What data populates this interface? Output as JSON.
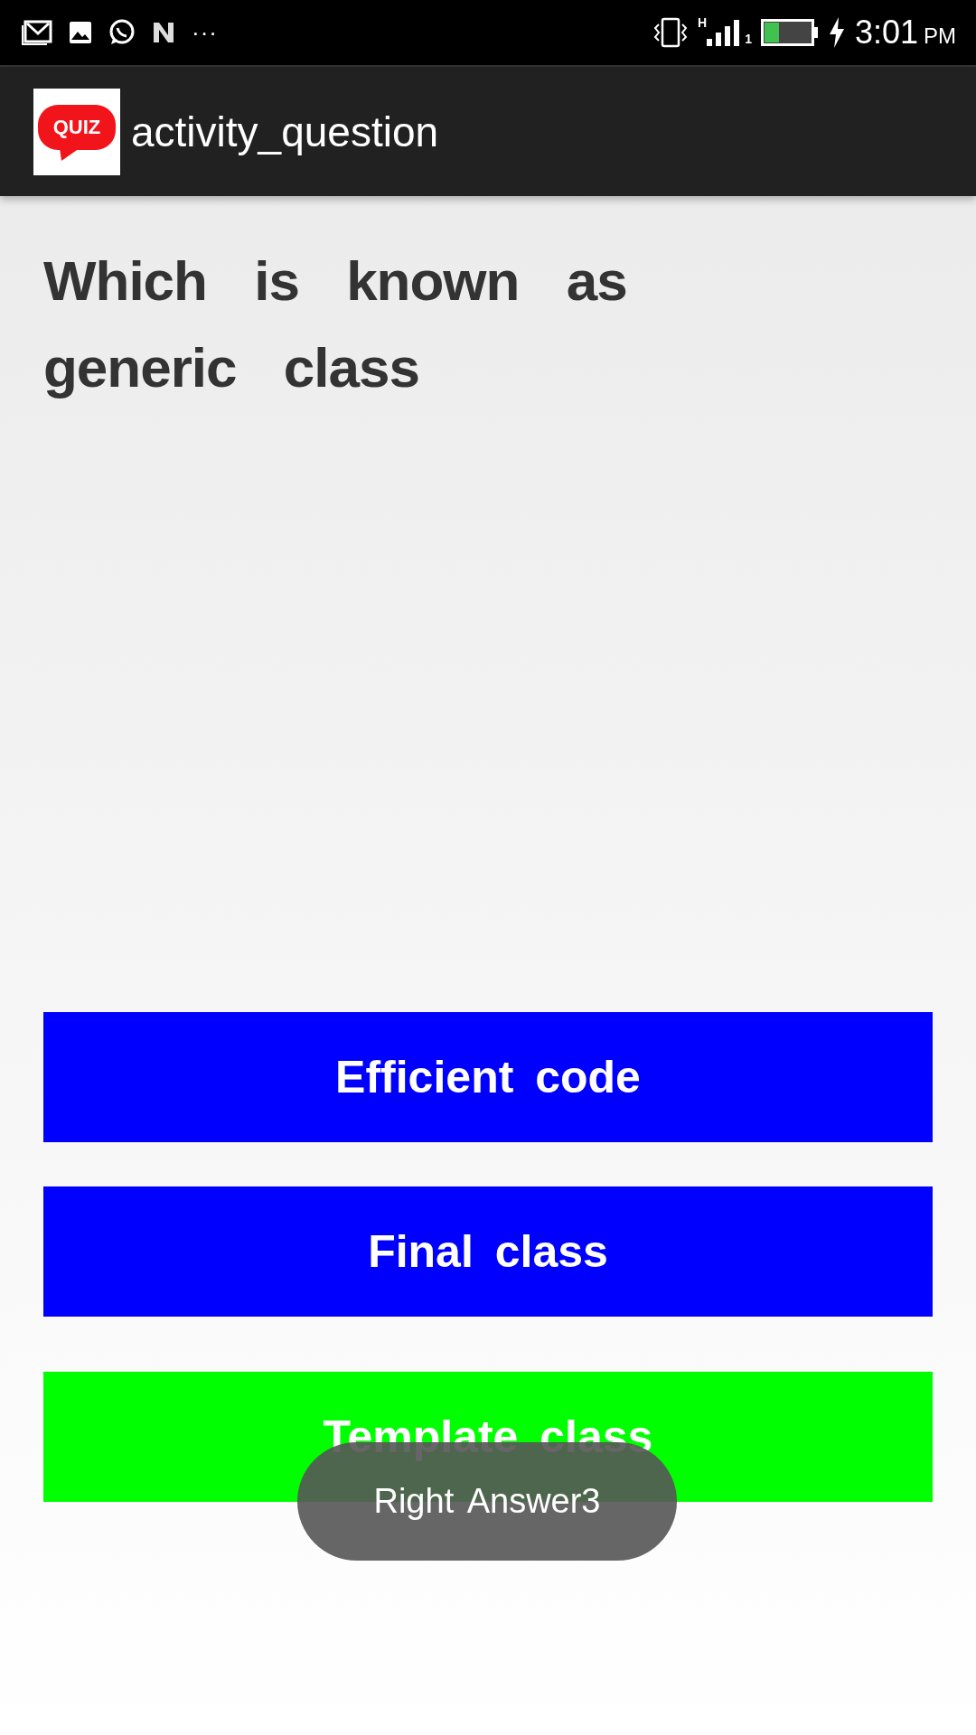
{
  "status_bar": {
    "network_type": "H",
    "sim": "1",
    "time": "3:01",
    "period": "PM",
    "more": "···"
  },
  "app_bar": {
    "logo_text": "QUIZ",
    "title": "activity_question"
  },
  "question": "Which is known as generic class",
  "answers": [
    {
      "label": "Efficient code",
      "kind": "plain"
    },
    {
      "label": "Final class",
      "kind": "plain"
    },
    {
      "label": "Template class",
      "kind": "correct"
    }
  ],
  "toast": "Right Answer3"
}
